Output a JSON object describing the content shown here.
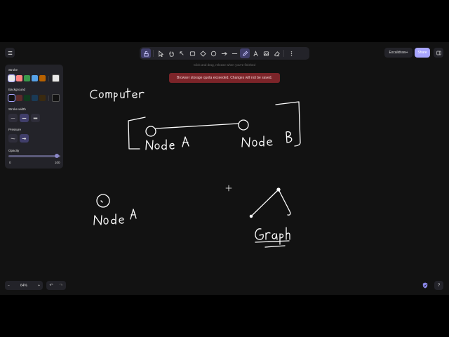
{
  "toolbar": {
    "tools": [
      {
        "name": "lock",
        "icon": "lock-icon",
        "active": true
      },
      {
        "name": "selection",
        "icon": "pointer-icon",
        "active": false
      },
      {
        "name": "hand",
        "icon": "hand-icon",
        "active": false
      },
      {
        "name": "selection-alt",
        "icon": "cursor-icon",
        "active": false,
        "shortcut": "1"
      },
      {
        "name": "rectangle",
        "icon": "rectangle-icon",
        "active": false,
        "shortcut": "2"
      },
      {
        "name": "diamond",
        "icon": "diamond-icon",
        "active": false,
        "shortcut": "3"
      },
      {
        "name": "ellipse",
        "icon": "ellipse-icon",
        "active": false,
        "shortcut": "4"
      },
      {
        "name": "arrow",
        "icon": "arrow-icon",
        "active": false,
        "shortcut": "5"
      },
      {
        "name": "line",
        "icon": "line-icon",
        "active": false,
        "shortcut": "6"
      },
      {
        "name": "draw",
        "icon": "pencil-icon",
        "active": true,
        "shortcut": "7"
      },
      {
        "name": "text",
        "icon": "text-icon",
        "active": false,
        "shortcut": "8"
      },
      {
        "name": "image",
        "icon": "image-icon",
        "active": false,
        "shortcut": "9"
      },
      {
        "name": "eraser",
        "icon": "eraser-icon",
        "active": false,
        "shortcut": "0"
      },
      {
        "name": "more",
        "icon": "more-icon",
        "active": false
      }
    ]
  },
  "hint": "Click and drag, release when you're finished",
  "toast": "Browser storage quota exceeded. Changes will not be saved.",
  "header": {
    "excalidraw_plus": "Excalidraw+",
    "share": "Share"
  },
  "panel": {
    "stroke_label": "Stroke",
    "stroke_colors": [
      "#e8e8e8",
      "#ff8383",
      "#3a994c",
      "#56a2e8",
      "#b76100"
    ],
    "stroke_current": "#e8e8e8",
    "background_label": "Background",
    "background_colors": [
      "#121212",
      "#5c2b2b",
      "#103a1f",
      "#1a3a56",
      "#3a2a10"
    ],
    "background_current": "#121212",
    "stroke_width_label": "Stroke width",
    "pressure_label": "Pressure",
    "opacity_label": "Opacity",
    "opacity_min": "0",
    "opacity_max": "100",
    "opacity_value": 100
  },
  "footer": {
    "zoom_out": "−",
    "zoom_level": "64%",
    "zoom_in": "+",
    "undo": "↶",
    "redo": "↷",
    "help": "?"
  },
  "colors": {
    "accent": "#a8a5ff",
    "active_tool": "#403e6a",
    "toast_bg": "#7c2429",
    "ink": "#ffffff"
  }
}
